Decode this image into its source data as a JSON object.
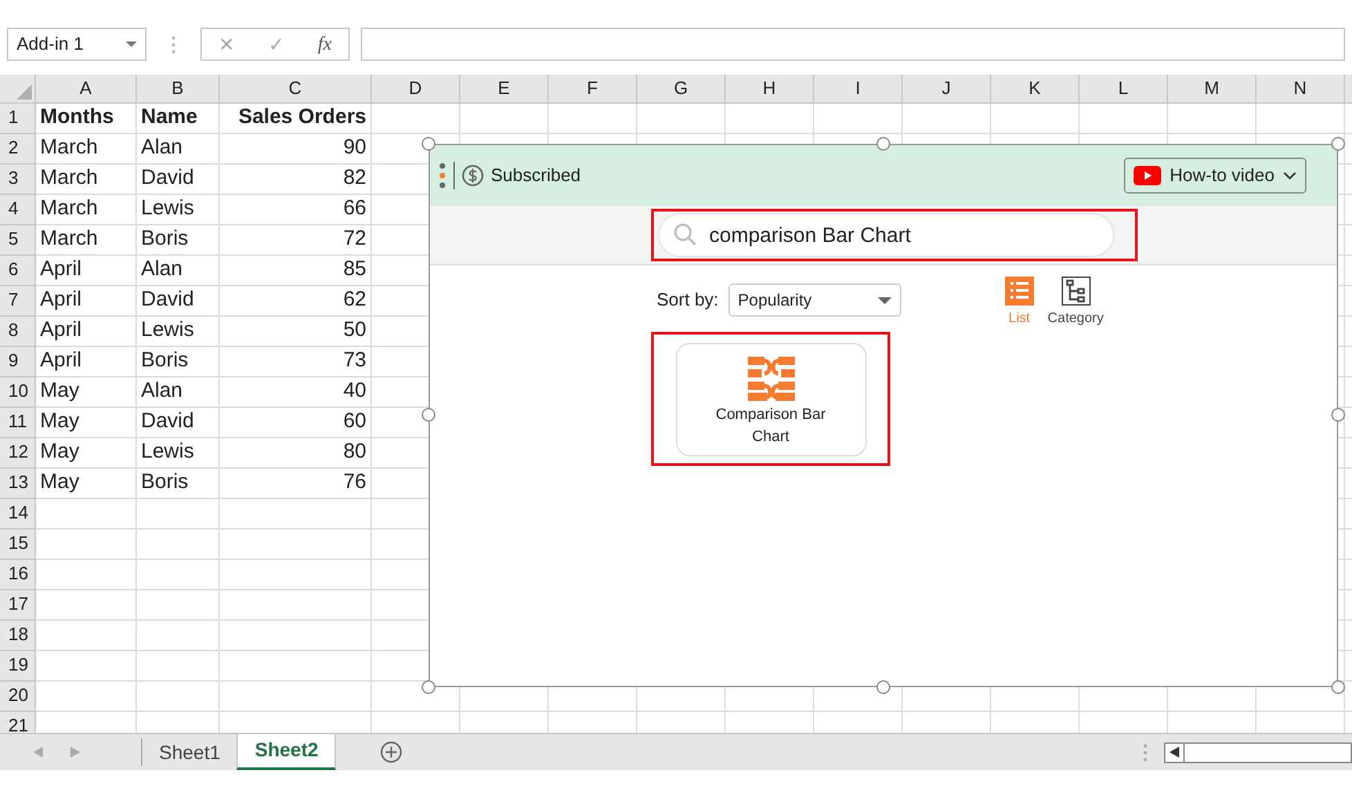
{
  "name_box": {
    "value": "Add-in 1"
  },
  "formula_bar": {
    "cancel": "✕",
    "enter": "✓",
    "function": "fx"
  },
  "columns": [
    "A",
    "B",
    "C",
    "D",
    "E",
    "F",
    "G",
    "H",
    "I",
    "J",
    "K",
    "L",
    "M",
    "N"
  ],
  "header_row": {
    "number": "1",
    "cells": [
      "Months",
      "Name",
      "Sales Orders"
    ]
  },
  "rows": [
    {
      "number": "2",
      "cells": [
        "March",
        "Alan",
        "90"
      ]
    },
    {
      "number": "3",
      "cells": [
        "March",
        "David",
        "82"
      ]
    },
    {
      "number": "4",
      "cells": [
        "March",
        "Lewis",
        "66"
      ]
    },
    {
      "number": "5",
      "cells": [
        "March",
        "Boris",
        "72"
      ]
    },
    {
      "number": "6",
      "cells": [
        "April",
        "Alan",
        "85"
      ]
    },
    {
      "number": "7",
      "cells": [
        "April",
        "David",
        "62"
      ]
    },
    {
      "number": "8",
      "cells": [
        "April",
        "Lewis",
        "50"
      ]
    },
    {
      "number": "9",
      "cells": [
        "April",
        "Boris",
        "73"
      ]
    },
    {
      "number": "10",
      "cells": [
        "May",
        "Alan",
        "40"
      ]
    },
    {
      "number": "11",
      "cells": [
        "May",
        "David",
        "60"
      ]
    },
    {
      "number": "12",
      "cells": [
        "May",
        "Lewis",
        "80"
      ]
    },
    {
      "number": "13",
      "cells": [
        "May",
        "Boris",
        "76"
      ]
    },
    {
      "number": "14",
      "cells": []
    },
    {
      "number": "15",
      "cells": []
    },
    {
      "number": "16",
      "cells": []
    },
    {
      "number": "17",
      "cells": []
    },
    {
      "number": "18",
      "cells": []
    },
    {
      "number": "19",
      "cells": []
    },
    {
      "number": "20",
      "cells": []
    },
    {
      "number": "21",
      "cells": []
    }
  ],
  "panel": {
    "status": "Subscribed",
    "video_button": "How-to video",
    "search": {
      "value": "comparison Bar Chart"
    },
    "sort_label": "Sort by:",
    "sort": {
      "value": "Popularity"
    },
    "views": [
      {
        "label": "List",
        "selected": true
      },
      {
        "label": "Category",
        "selected": false
      }
    ],
    "results": [
      {
        "title": "Comparison Bar Chart"
      }
    ]
  },
  "sheet_tabs": [
    {
      "label": "Sheet1",
      "selected": false
    },
    {
      "label": "Sheet2",
      "selected": true
    }
  ]
}
